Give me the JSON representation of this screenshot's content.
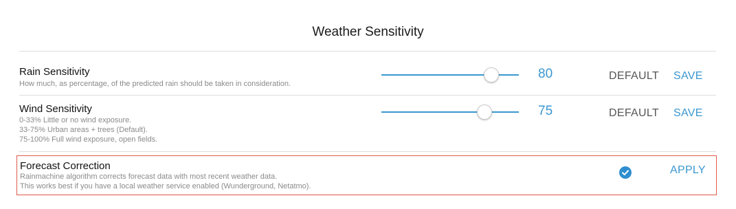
{
  "page": {
    "title": "Weather Sensitivity"
  },
  "rain": {
    "title": "Rain Sensitivity",
    "description": "How much, as percentage, of the predicted rain should be taken in consideration.",
    "value": "80",
    "default_label": "DEFAULT",
    "save_label": "SAVE"
  },
  "wind": {
    "title": "Wind Sensitivity",
    "description_lines": [
      "0-33% Little or no wind exposure.",
      "33-75% Urban areas + trees (Default).",
      "75-100% Full wind exposure, open fields."
    ],
    "value": "75",
    "default_label": "DEFAULT",
    "save_label": "SAVE"
  },
  "forecast": {
    "title": "Forecast Correction",
    "description_lines": [
      "Rainmachine algorithm corrects forecast data with most recent weather data.",
      "This works best if you have a local weather service enabled (Wunderground, Netatmo)."
    ],
    "enabled": true,
    "apply_label": "APPLY"
  },
  "colors": {
    "accent": "#3a97d0",
    "highlight_border": "#e05a4a"
  },
  "icons": {
    "forecast_checkbox": "check-circle-icon"
  }
}
